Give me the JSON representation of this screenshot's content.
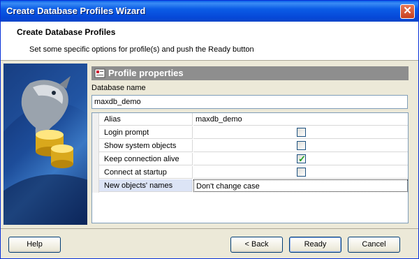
{
  "window": {
    "title": "Create Database Profiles Wizard",
    "close_icon": "close-icon"
  },
  "header": {
    "title": "Create Database Profiles",
    "subtitle": "Set some specific options for profile(s) and push the Ready button"
  },
  "panel": {
    "title": "Profile properties",
    "icon": "profile-properties-icon",
    "db_name_label": "Database name",
    "db_name_value": "maxdb_demo"
  },
  "properties": [
    {
      "name": "Alias",
      "value": "maxdb_demo",
      "type": "text"
    },
    {
      "name": "Login prompt",
      "checked": false,
      "type": "checkbox"
    },
    {
      "name": "Show system objects",
      "checked": false,
      "type": "checkbox"
    },
    {
      "name": "Keep connection alive",
      "checked": true,
      "type": "checkbox"
    },
    {
      "name": "Connect at startup",
      "checked": false,
      "type": "checkbox"
    },
    {
      "name": "New objects' names",
      "value": "Don't change case",
      "type": "text",
      "selected": true
    }
  ],
  "buttons": {
    "help": "Help",
    "back": "< Back",
    "ready": "Ready",
    "cancel": "Cancel"
  },
  "colors": {
    "titlebar": "#0a5fe9",
    "panel_header": "#8e8e8e",
    "checkmark": "#21a121"
  }
}
